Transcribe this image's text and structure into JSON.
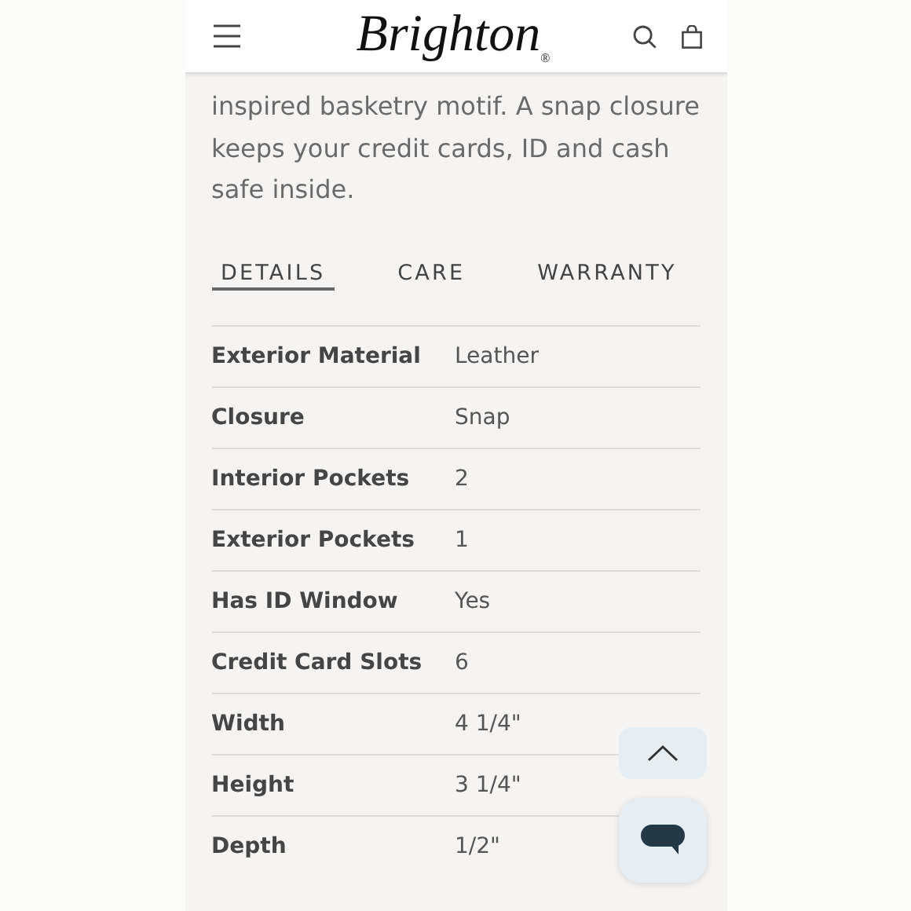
{
  "header": {
    "logo": "Brighton",
    "logo_mark": "®"
  },
  "description": "inspired basketry motif. A snap closure keeps your credit cards, ID and cash safe inside.",
  "tabs": [
    {
      "label": "DETAILS",
      "selected": true
    },
    {
      "label": "CARE",
      "selected": false
    },
    {
      "label": "WARRANTY",
      "selected": false
    }
  ],
  "details": [
    {
      "label": "Exterior Material",
      "value": "Leather"
    },
    {
      "label": "Closure",
      "value": "Snap"
    },
    {
      "label": "Interior Pockets",
      "value": "2"
    },
    {
      "label": "Exterior Pockets",
      "value": "1"
    },
    {
      "label": "Has ID Window",
      "value": "Yes"
    },
    {
      "label": "Credit Card Slots",
      "value": "6"
    },
    {
      "label": "Width",
      "value": "4 1/4\""
    },
    {
      "label": "Height",
      "value": "3 1/4\""
    },
    {
      "label": "Depth",
      "value": "1/2\""
    }
  ]
}
